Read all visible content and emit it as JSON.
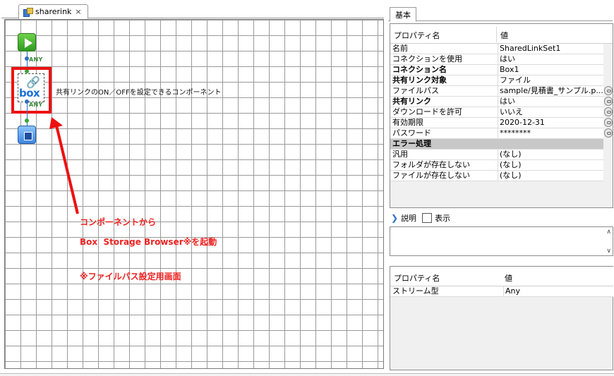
{
  "editor": {
    "tab_title": "sharerink",
    "tab_close": "×",
    "flow_label_1": "ANY",
    "flow_label_2": "ANY",
    "component_description": "共有リンクのON／OFFを設定できるコンポーネント"
  },
  "annotation": {
    "line1": "コンポーネントから",
    "line2": "Box  Storage Browser※を起動",
    "line3": "※ファイルパス設定用画面",
    "color": "#ee2222"
  },
  "panel": {
    "tab_label": "基本",
    "header_name": "プロパティ名",
    "header_value": "値",
    "rows": [
      {
        "key": "名前",
        "value": "SharedLinkSet1"
      },
      {
        "key": "コネクションを使用",
        "value": "はい"
      },
      {
        "key": "コネクション名",
        "value": "Box1"
      },
      {
        "key": "共有リンク対象",
        "value": "ファイル"
      },
      {
        "key": "ファイルパス",
        "value": "sample/見積書_サンプル.p..."
      },
      {
        "key": "共有リンク",
        "value": "はい"
      },
      {
        "key": "ダウンロードを許可",
        "value": "いいえ"
      },
      {
        "key": "有効期限",
        "value": "2020-12-31"
      },
      {
        "key": "パスワード",
        "value": "********"
      },
      {
        "key": "エラー処理",
        "value": ""
      },
      {
        "key": "汎用",
        "value": "(なし)"
      },
      {
        "key": "フォルダが存在しない",
        "value": "(なし)"
      },
      {
        "key": "ファイルが存在しない",
        "value": "(なし)"
      }
    ],
    "description_label": "説明",
    "display_label": "表示",
    "stream_header_name": "プロパティ名",
    "stream_header_value": "値",
    "stream_key": "ストリーム型",
    "stream_value": "Any"
  }
}
